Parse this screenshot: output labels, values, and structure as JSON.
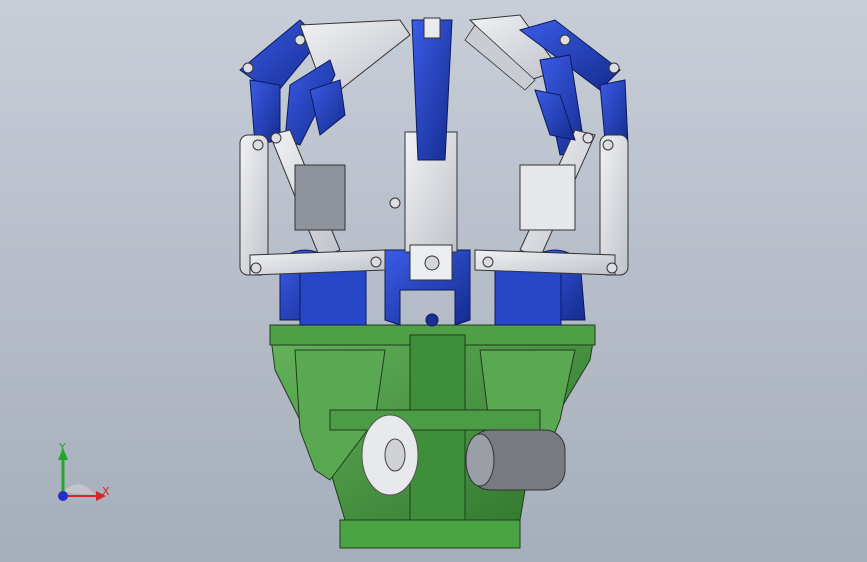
{
  "viewport": {
    "background_top": "#c8ced8",
    "background_bottom": "#a6aebb"
  },
  "model": {
    "colors": {
      "blue_parts": "#1f3fb8",
      "light_gray_parts": "#d9dbe0",
      "green_base": "#3f8f3a"
    }
  },
  "triad": {
    "x_label": "X",
    "y_label": "Y",
    "x_color": "#d32626",
    "y_color": "#24a52c",
    "z_color": "#2230c8"
  }
}
